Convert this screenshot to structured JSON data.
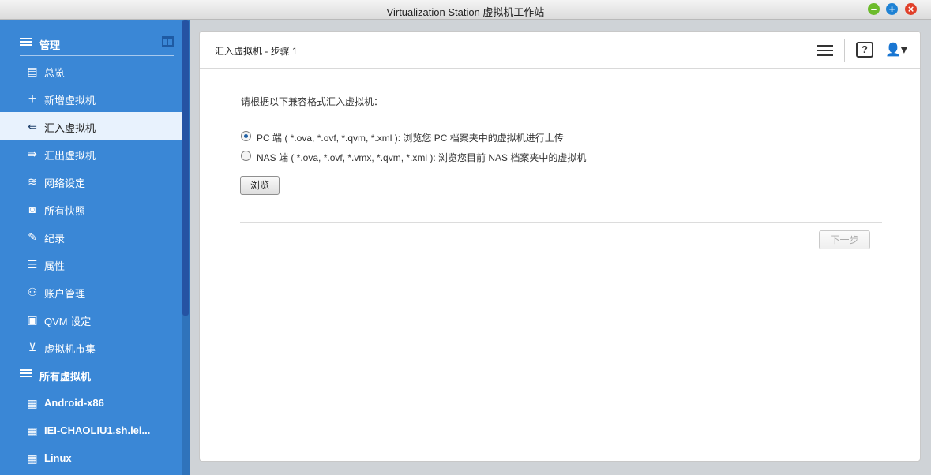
{
  "window": {
    "title": "Virtualization Station 虚拟机工作站",
    "controls": [
      "minimize",
      "maximize",
      "close"
    ]
  },
  "sidebar": {
    "manage_section": {
      "label": "管理",
      "icon": "menu-lines-icon"
    },
    "manage_items": [
      {
        "label": "总览",
        "icon": "overview-icon"
      },
      {
        "label": "新增虚拟机",
        "icon": "plus-icon"
      },
      {
        "label": "汇入虚拟机",
        "icon": "import-icon",
        "active": true
      },
      {
        "label": "汇出虚拟机",
        "icon": "export-icon"
      },
      {
        "label": "网络设定",
        "icon": "network-icon"
      },
      {
        "label": "所有快照",
        "icon": "camera-icon"
      },
      {
        "label": "纪录",
        "icon": "log-icon"
      },
      {
        "label": "属性",
        "icon": "properties-icon"
      },
      {
        "label": "账户管理",
        "icon": "users-icon"
      },
      {
        "label": "QVM 设定",
        "icon": "monitor-icon"
      },
      {
        "label": "虚拟机市集",
        "icon": "market-icon"
      }
    ],
    "vms_section": {
      "label": "所有虚拟机",
      "icon": "menu-lines-icon"
    },
    "vm_items": [
      {
        "label": "Android-x86",
        "icon": "vm-grid-icon"
      },
      {
        "label": "IEI-CHAOLIU1.sh.iei...",
        "icon": "vm-grid-icon"
      },
      {
        "label": "Linux",
        "icon": "vm-grid-icon"
      }
    ]
  },
  "main": {
    "title": "汇入虚拟机 - 步骤 1",
    "prompt": "请根据以下兼容格式汇入虚拟机：",
    "options": [
      {
        "label": "PC 端 ( *.ova, *.ovf, *.qvm, *.xml ): 浏览您 PC 档案夹中的虚拟机进行上传",
        "checked": true
      },
      {
        "label": "NAS 端 ( *.ova, *.ovf, *.vmx, *.qvm, *.xml ): 浏览您目前 NAS 档案夹中的虚拟机",
        "checked": false
      }
    ],
    "browse_label": "浏览",
    "next_label": "下一步",
    "help_glyph": "?"
  }
}
